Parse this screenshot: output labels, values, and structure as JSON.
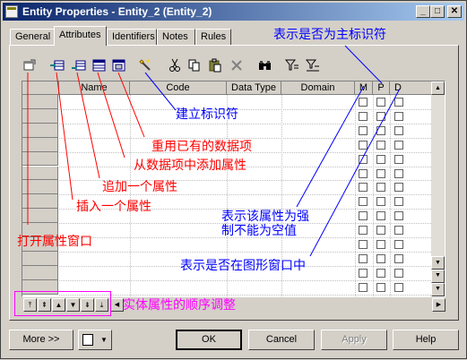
{
  "window": {
    "title": "Entity Properties - Entity_2 (Entity_2)"
  },
  "title_buttons": [
    "_",
    "□",
    "✕"
  ],
  "tabs": [
    {
      "label": "General",
      "active": false
    },
    {
      "label": "Attributes",
      "active": true
    },
    {
      "label": "Identifiers",
      "active": false
    },
    {
      "label": "Notes",
      "active": false
    },
    {
      "label": "Rules",
      "active": false
    }
  ],
  "toolbar": [
    "properties-icon",
    "insert-row-icon",
    "add-row-icon",
    "add-from-dataitem-icon",
    "reuse-dataitem-icon",
    "create-identifier-icon",
    "cut-icon",
    "copy-icon",
    "paste-icon",
    "delete-icon",
    "find-icon",
    "filter-icon",
    "clear-filter-icon"
  ],
  "grid": {
    "columns": [
      "Name",
      "Code",
      "Data Type",
      "Domain",
      "M",
      "P",
      "D"
    ]
  },
  "annotations": {
    "primary_identifier": "表示是否为主标识符",
    "create_identifier": "建立标识符",
    "reuse_dataitem": "重用已有的数据项",
    "add_from_dataitem": "从数据项中添加属性",
    "add_attribute": "追加一个属性",
    "insert_attribute": "插入一个属性",
    "open_properties": "打开属性窗口",
    "mandatory_line1": "表示该属性为强",
    "mandatory_line2": "制不能为空值",
    "displayed": "表示是否在图形窗口中",
    "order_adjust": "实体属性的顺序调整"
  },
  "buttons": {
    "more": "More >>",
    "ok": "OK",
    "cancel": "Cancel",
    "apply": "Apply",
    "help": "Help"
  },
  "colors": {
    "annotation_red": "#ff0000",
    "annotation_blue": "#0000ff",
    "annotation_magenta": "#ff00ff",
    "title_bar": "#0a246a"
  }
}
